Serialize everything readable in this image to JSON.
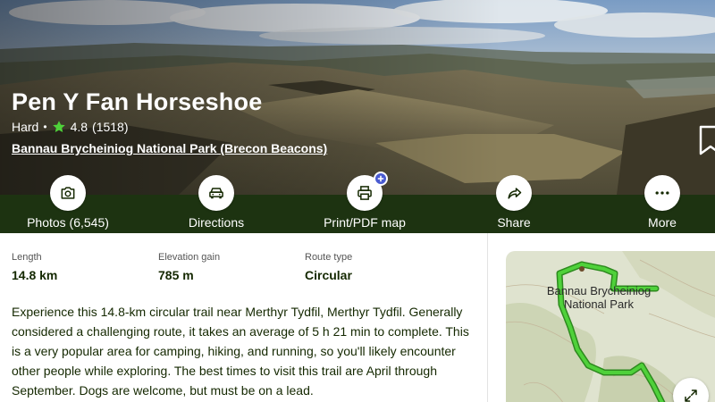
{
  "trail": {
    "title": "Pen Y Fan Horseshoe",
    "difficulty": "Hard",
    "separator": "•",
    "rating": "4.8",
    "review_count": "(1518)",
    "park": "Bannau Brycheiniog National Park (Brecon Beacons)"
  },
  "actions": [
    {
      "label": "Photos (6,545)",
      "icon": "camera-icon"
    },
    {
      "label": "Directions",
      "icon": "car-icon"
    },
    {
      "label": "Print/PDF map",
      "icon": "printer-icon",
      "badge": "plus"
    },
    {
      "label": "Share",
      "icon": "share-arrow-icon"
    },
    {
      "label": "More",
      "icon": "more-dots-icon"
    }
  ],
  "stats": [
    {
      "key": "Length",
      "value": "14.8 km"
    },
    {
      "key": "Elevation gain",
      "value": "785 m"
    },
    {
      "key": "Route type",
      "value": "Circular"
    }
  ],
  "description": "Experience this 14.8-km circular trail near Merthyr Tydfil, Merthyr Tydfil. Generally considered a challenging route, it takes an average of 5 h 21 min to complete. This is a very popular area for camping, hiking, and running, so you'll likely encounter other people while exploring. The best times to visit this trail are April through September. Dogs are welcome, but must be on a lead.",
  "map": {
    "label": "Bannau Brycheiniog National Park"
  },
  "colors": {
    "action_bar": "#1d3311",
    "text_dark": "#142800",
    "route_green": "#4fd13a",
    "rating_star": "#4fd13a",
    "badge": "#4a5bd1"
  }
}
